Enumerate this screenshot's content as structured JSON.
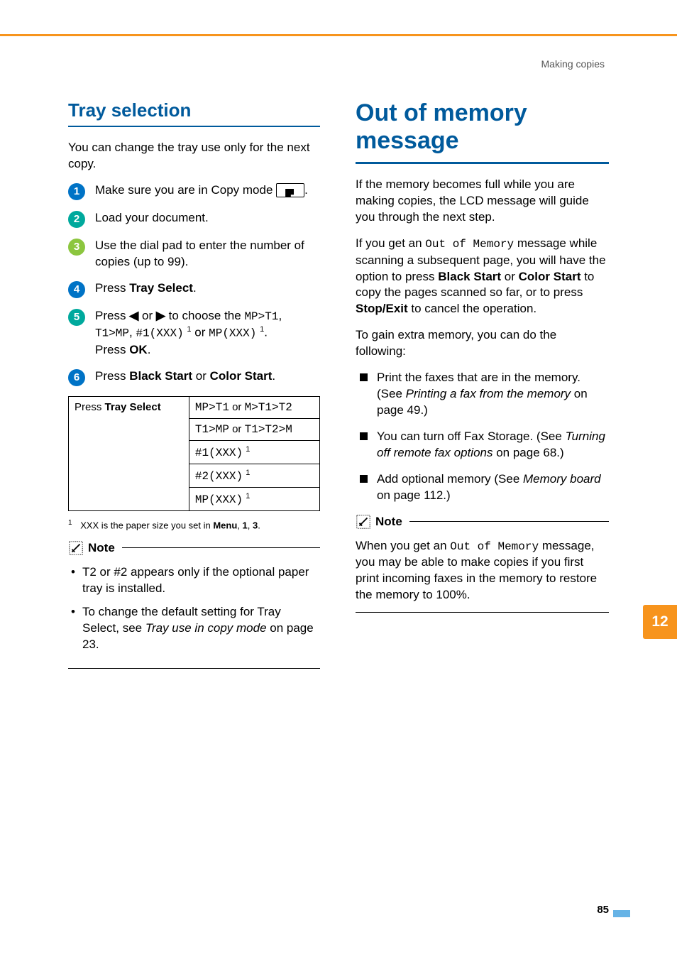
{
  "running_head": "Making copies",
  "page_number": "85",
  "page_tab": "12",
  "left": {
    "heading": "Tray selection",
    "intro": "You can change the tray use only for the next copy.",
    "steps": {
      "s1_a": "Make sure you are in Copy mode ",
      "s1_b": ".",
      "s2": "Load your document.",
      "s3": "Use the dial pad to enter the number of copies (up to 99).",
      "s4_a": "Press ",
      "s4_b": "Tray Select",
      "s4_c": ".",
      "s5_a": "Press ",
      "s5_arrow_l": "◀",
      "s5_or": " or ",
      "s5_arrow_r": "▶",
      "s5_b": " to choose the ",
      "s5_opt1": "MP>T1",
      "s5_c": ", ",
      "s5_opt2": "T1>MP",
      "s5_d": ", ",
      "s5_opt3": "#1(XXX)",
      "s5_e": " ",
      "s5_or2": "or ",
      "s5_opt4": "MP(XXX)",
      "s5_f": ". ",
      "s5_press": "Press ",
      "s5_ok": "OK",
      "s5_g": ".",
      "fnref": "1",
      "s6_a": "Press ",
      "s6_b": "Black Start",
      "s6_c": " or ",
      "s6_d": "Color Start",
      "s6_e": "."
    },
    "table": {
      "left_a": "Press ",
      "left_b": "Tray Select",
      "r1_a": "MP>T1",
      "r1_or": " or ",
      "r1_b": "M>T1>T2",
      "r2_a": "T1>MP",
      "r2_or": " or ",
      "r2_b": "T1>T2>M",
      "r3": "#1(XXX)",
      "r3_fn": "1",
      "r4": "#2(XXX)",
      "r4_fn": "1",
      "r5": "MP(XXX)",
      "r5_fn": "1"
    },
    "footnote": {
      "num": "1",
      "a": "XXX is the paper size you set in ",
      "b": "Menu",
      "c": ", ",
      "d": "1",
      "e": ", ",
      "f": "3",
      "g": "."
    },
    "note": {
      "label": "Note",
      "li1": "T2 or #2 appears only if the optional paper tray is installed.",
      "li2_a": "To change the default setting for Tray Select, see ",
      "li2_b": "Tray use in copy mode",
      "li2_c": " on page 23."
    }
  },
  "right": {
    "heading_l1": "Out of memory",
    "heading_l2": "message",
    "p1": "If the memory becomes full while you are making copies, the LCD message will guide you through the next step.",
    "p2_a": "If you get an ",
    "p2_b": "Out of Memory",
    "p2_c": " message while scanning a subsequent page, you will have the option to press ",
    "p2_d": "Black Start",
    "p2_e": " or ",
    "p2_f": "Color Start",
    "p2_g": " to copy the pages scanned so far, or to press ",
    "p2_h": "Stop/Exit",
    "p2_i": " to cancel the operation.",
    "p3": "To gain extra memory, you can do the following:",
    "li1_a": "Print the faxes that are in the memory. (See ",
    "li1_b": "Printing a fax from the memory",
    "li1_c": " on page 49.)",
    "li2_a": "You can turn off Fax Storage. (See ",
    "li2_b": "Turning off remote fax options",
    "li2_c": " on page 68.)",
    "li3_a": "Add optional memory (See ",
    "li3_b": "Memory board",
    "li3_c": " on page 112.)",
    "note": {
      "label": "Note",
      "body_a": "When you get an ",
      "body_b": "Out of Memory",
      "body_c": " message, you may be able to make copies if you first print incoming faxes in the memory to restore the memory to 100%."
    }
  }
}
